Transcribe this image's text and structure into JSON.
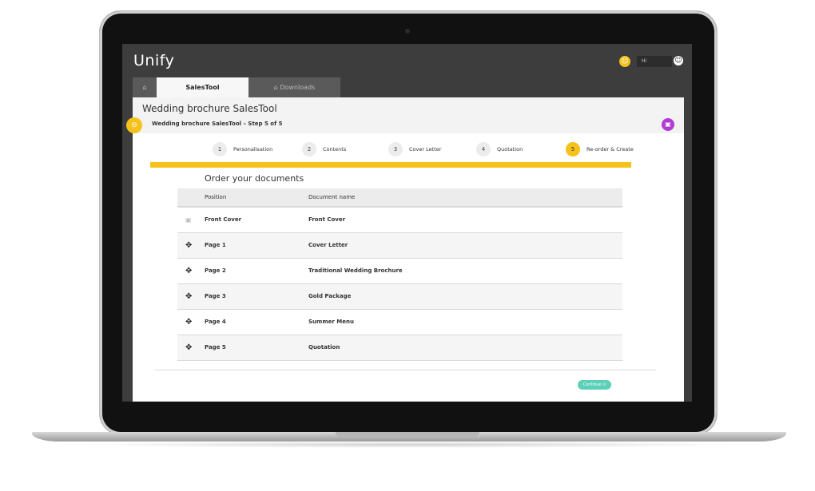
{
  "app": {
    "logo": "Unify",
    "greeting": "Hi",
    "user_initial": "☺"
  },
  "tabs": [
    {
      "label": "⌂"
    },
    {
      "label": "SalesTool"
    },
    {
      "label": "⌂  Downloads"
    }
  ],
  "header": {
    "title": "Wedding brochure SalesTool",
    "step_label": "Wedding brochure SalesTool – Step 5 of 5"
  },
  "steps": [
    {
      "num": "1",
      "label": "Personalisation"
    },
    {
      "num": "2",
      "label": "Contents"
    },
    {
      "num": "3",
      "label": "Cover Letter"
    },
    {
      "num": "4",
      "label": "Quotation"
    },
    {
      "num": "5",
      "label": "Re-order & Create"
    }
  ],
  "progress_fraction": 1.0,
  "section_title": "Order your documents",
  "table": {
    "headers": {
      "position": "Position",
      "document": "Document name"
    },
    "rows": [
      {
        "icon": "lock-icon",
        "position": "Front Cover",
        "document": "Front Cover"
      },
      {
        "icon": "move-icon",
        "position": "Page 1",
        "document": "Cover Letter"
      },
      {
        "icon": "move-icon",
        "position": "Page 2",
        "document": "Traditional Wedding Brochure"
      },
      {
        "icon": "move-icon",
        "position": "Page 3",
        "document": "Gold Package"
      },
      {
        "icon": "move-icon",
        "position": "Page 4",
        "document": "Summer Menu"
      },
      {
        "icon": "move-icon",
        "position": "Page 5",
        "document": "Quotation"
      }
    ]
  },
  "buttons": {
    "continue": "Continue  ⊙"
  },
  "colors": {
    "accent": "#f5c21b",
    "continue": "#5cd0b8",
    "purple": "#b23ad6",
    "topbar": "#3d3d3d"
  }
}
